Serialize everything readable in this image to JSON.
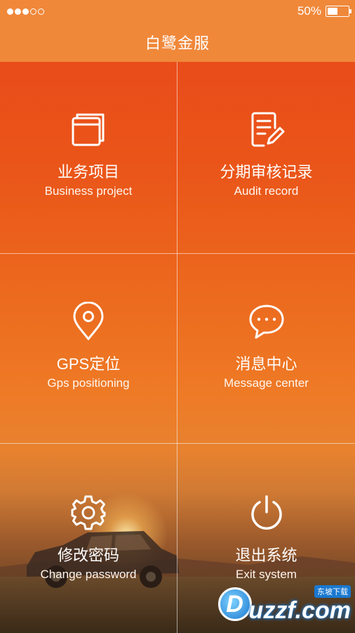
{
  "status_bar": {
    "battery_text": "50%",
    "battery_level": 0.5,
    "signal_filled": 3,
    "signal_total": 5
  },
  "header": {
    "title": "白鹭金服"
  },
  "menu": [
    {
      "icon": "browser-windows-icon",
      "zh": "业务项目",
      "en": "Business project"
    },
    {
      "icon": "edit-document-icon",
      "zh": "分期审核记录",
      "en": "Audit record"
    },
    {
      "icon": "location-pin-icon",
      "zh": "GPS定位",
      "en": "Gps positioning"
    },
    {
      "icon": "chat-bubble-icon",
      "zh": "消息中心",
      "en": "Message center"
    },
    {
      "icon": "gear-icon",
      "zh": "修改密码",
      "en": "Change password"
    },
    {
      "icon": "power-icon",
      "zh": "退出系统",
      "en": "Exit system"
    }
  ],
  "watermark": {
    "main": "uzzf.com",
    "sub": "东坡下载",
    "letter": "D"
  }
}
